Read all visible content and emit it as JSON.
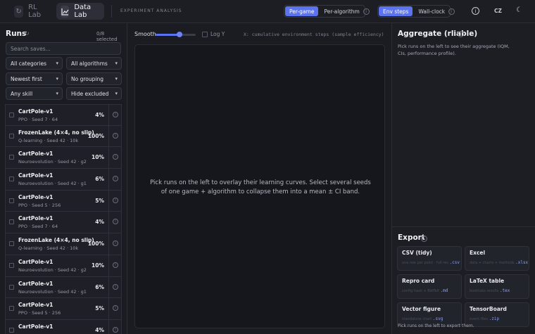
{
  "topbar": {
    "tabs": [
      {
        "label": "RL Lab",
        "icon": "refresh-loop-icon"
      },
      {
        "label": "Data Lab",
        "icon": "chart-line-icon"
      }
    ],
    "section_title": "EXPERIMENT ANALYSIS",
    "view_toggle": {
      "options": [
        "Per-game",
        "Per-algorithm"
      ],
      "selected": "Per-game"
    },
    "axis_toggle": {
      "options": [
        "Env steps",
        "Wall-clock"
      ],
      "selected": "Env steps"
    },
    "language": "CZ",
    "accent": "#5b73f0"
  },
  "runs_panel": {
    "title": "Runs",
    "selected_count": "0/8 selected",
    "search_placeholder": "Search saves...",
    "filters": {
      "category": "All categories",
      "algorithm": "All algorithms",
      "sort": "Newest first",
      "grouping": "No grouping",
      "skill": "Any skill",
      "excluded": "Hide excluded"
    },
    "runs": [
      {
        "name": "CartPole-v1",
        "sub": "PPO · Seed 7 · 64",
        "pct": "4%"
      },
      {
        "name": "FrozenLake (4×4, no slip)",
        "sub": "Q-learning · Seed 42 · 10k",
        "pct": "100%"
      },
      {
        "name": "CartPole-v1",
        "sub": "Neuroevolution · Seed 42 · g2",
        "pct": "10%"
      },
      {
        "name": "CartPole-v1",
        "sub": "Neuroevolution · Seed 42 · g1",
        "pct": "6%"
      },
      {
        "name": "CartPole-v1",
        "sub": "PPO · Seed 5 · 256",
        "pct": "5%"
      },
      {
        "name": "CartPole-v1",
        "sub": "PPO · Seed 7 · 64",
        "pct": "4%"
      },
      {
        "name": "FrozenLake (4×4, no slip)",
        "sub": "Q-learning · Seed 42 · 10k",
        "pct": "100%"
      },
      {
        "name": "CartPole-v1",
        "sub": "Neuroevolution · Seed 42 · g2",
        "pct": "10%"
      },
      {
        "name": "CartPole-v1",
        "sub": "Neuroevolution · Seed 42 · g1",
        "pct": "6%"
      },
      {
        "name": "CartPole-v1",
        "sub": "PPO · Seed 5 · 256",
        "pct": "5%"
      },
      {
        "name": "CartPole-v1",
        "sub": "",
        "pct": "4%"
      }
    ]
  },
  "plot_panel": {
    "smooth_label": "Smooth",
    "smooth_level": 0.6,
    "log_y_label": "Log Y",
    "x_axis_note": "X: cumulative environment steps (sample efficiency)",
    "empty_message": "Pick runs on the left to overlay their learning curves. Select several seeds of one game + algorithm to collapse them into a mean ± CI band."
  },
  "aggregate_panel": {
    "title": "Aggregate (rliable)",
    "message": "Pick runs on the left to see their aggregate (IQM, CIs, performance profile)."
  },
  "export_panel": {
    "title": "Export",
    "cards": [
      {
        "title": "CSV (tidy)",
        "desc": "one row per point · full res",
        "ext": ".csv"
      },
      {
        "title": "Excel",
        "desc": "data + charts + methods",
        "ext": ".xlsx"
      },
      {
        "title": "Repro card",
        "desc": "config hash + BibTeX",
        "ext": ".md"
      },
      {
        "title": "LaTeX table",
        "desc": "booktabs results",
        "ext": ".tex"
      },
      {
        "title": "Vector figure",
        "desc": "standalone chart",
        "ext": ".svg"
      },
      {
        "title": "TensorBoard",
        "desc": "event files",
        "ext": ".zip"
      }
    ],
    "footer": "Pick runs on the left to export them."
  }
}
